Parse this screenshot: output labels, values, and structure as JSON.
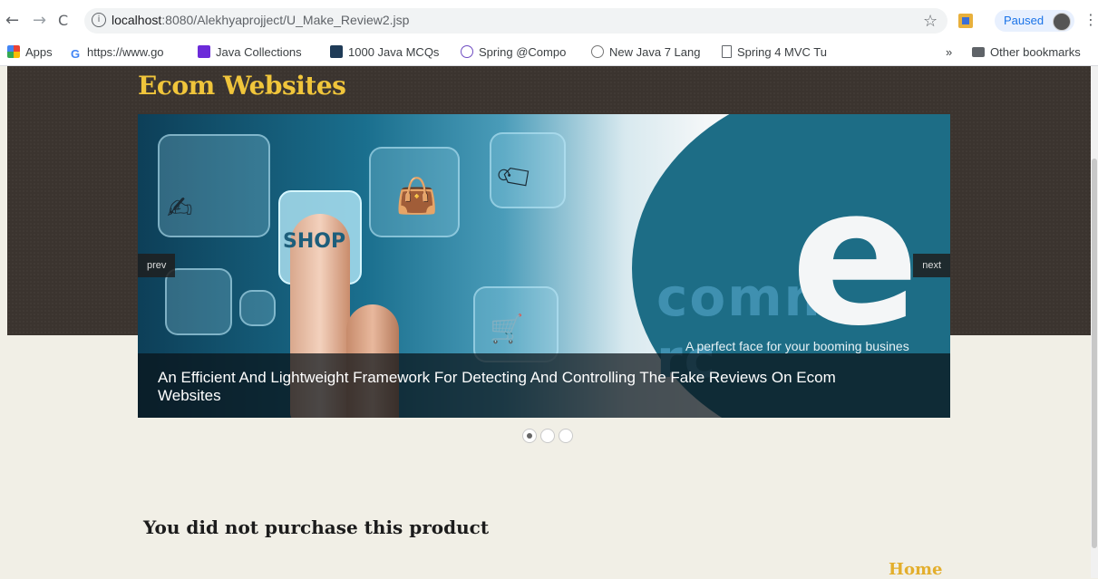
{
  "browser": {
    "url_host": "localhost",
    "url_rest": ":8080/Alekhyaprojject/U_Make_Review2.jsp",
    "profile_status": "Paused"
  },
  "bookmarks": [
    {
      "label": "Apps",
      "icon": "apps-grid-icon",
      "color": "#1a73e8"
    },
    {
      "label": "https://www.go",
      "icon": "google-icon",
      "color": "#4285f4"
    },
    {
      "label": "Java Collections",
      "icon": "d-logo-icon",
      "color": "#6c2bd9"
    },
    {
      "label": "1000 Java MCQs",
      "icon": "sf-logo-icon",
      "color": "#1f3b57"
    },
    {
      "label": "Spring @Compo",
      "icon": "spring-icon",
      "color": "#6d4bc1"
    },
    {
      "label": "New Java 7 Lang",
      "icon": "globe-icon",
      "color": "#777777"
    },
    {
      "label": "Spring 4 MVC Tu",
      "icon": "page-icon",
      "color": "#5f6368"
    }
  ],
  "bookmarks_more": "»",
  "bookmarks_other": "Other bookmarks",
  "site": {
    "title": "Ecom Websites",
    "slider": {
      "shop_text": "SHOP",
      "brand_text": "comm",
      "brand_text_end": "rc",
      "big_letter": "e",
      "tagline": "A perfect face for your booming busines",
      "caption": "An Efficient And Lightweight Framework For Detecting And Controlling The Fake Reviews On Ecom Websites",
      "prev_label": "prev",
      "next_label": "next",
      "active_index": 0,
      "slide_count": 3
    },
    "message": "You did not purchase this product",
    "home_link": "Home"
  },
  "colors": {
    "title_yellow": "#f0c53b",
    "home_yellow": "#e3ae2c",
    "band_dark": "#3b342f",
    "page_bg": "#f1efe6"
  }
}
